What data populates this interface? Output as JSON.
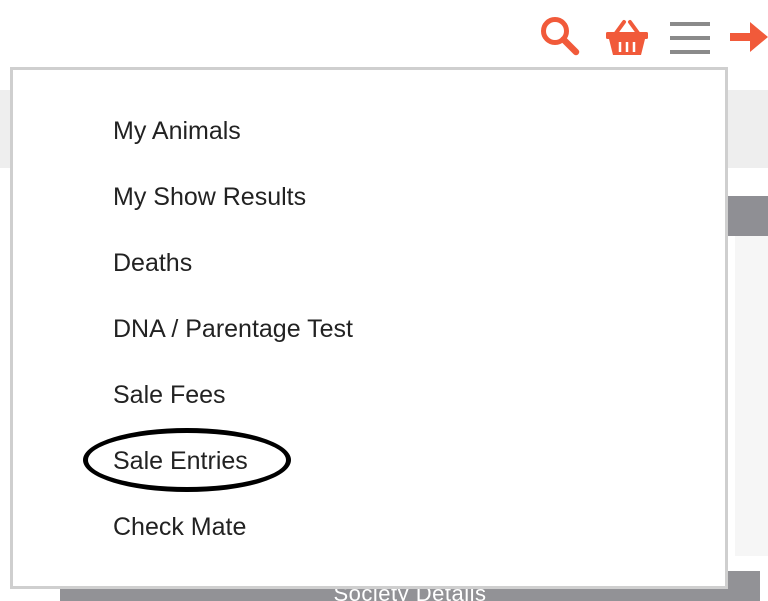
{
  "header": {
    "icons": [
      {
        "name": "search-icon",
        "color": "#f15a3a"
      },
      {
        "name": "basket-icon",
        "color": "#f15a3a"
      },
      {
        "name": "hamburger-menu-icon",
        "color": "#8a8a8a"
      },
      {
        "name": "arrow-right-icon",
        "color": "#f15a3a"
      }
    ]
  },
  "menu": {
    "items": [
      {
        "label": "My Animals"
      },
      {
        "label": "My Show Results"
      },
      {
        "label": "Deaths"
      },
      {
        "label": "DNA / Parentage Test"
      },
      {
        "label": "Sale Fees"
      },
      {
        "label": "Sale Entries",
        "annotated": true
      },
      {
        "label": "Check Mate"
      }
    ]
  },
  "background": {
    "footer_label": "Society Details"
  },
  "colors": {
    "accent": "#f15a3a",
    "menu_text": "#222222",
    "menu_border": "#cfcfcf",
    "gray_bar": "#929296",
    "annotation": "#000000"
  }
}
